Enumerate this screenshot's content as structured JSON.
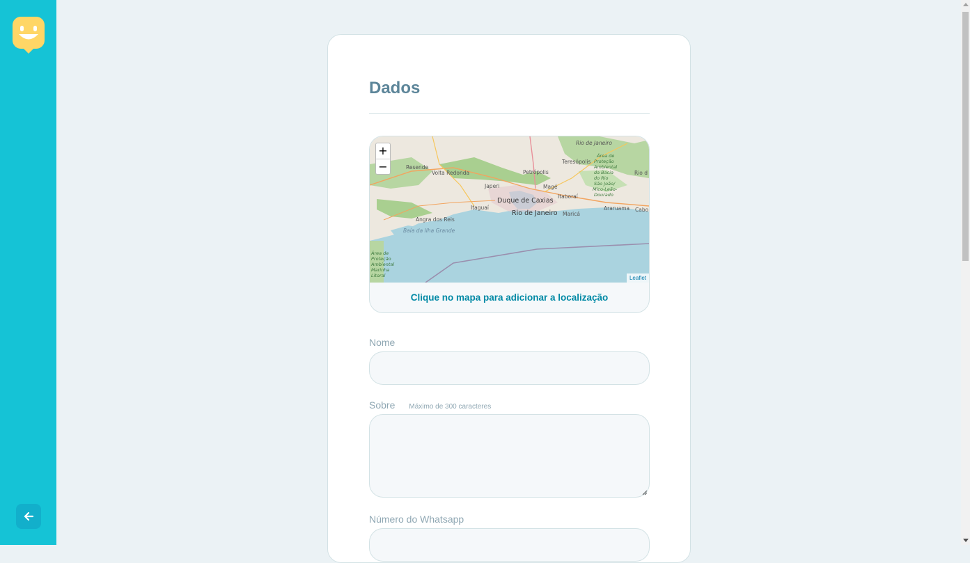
{
  "sidebar": {
    "logo_icon": "smiley-chat-icon",
    "back_icon": "arrow-left-icon"
  },
  "form": {
    "legend": "Dados",
    "map": {
      "zoom_in": "+",
      "zoom_out": "−",
      "attribution": "Leaflet",
      "cta": "Clique no mapa para adicionar a localização",
      "place_labels": [
        "Rio de Janeiro",
        "Teresópolis",
        "Resende",
        "Volta Redonda",
        "Petrópolis",
        "Área de Proteção Ambiental da Bacia do Rio São João/Mico-Leão-Dourado",
        "Rio d",
        "Japeri",
        "Magé",
        "Duque de Caxias",
        "Itaboraí",
        "Itaguaí",
        "Rio de Janeiro",
        "Maricá",
        "Araruama",
        "Cabo",
        "Angra dos Reis",
        "Baía da Ilha Grande",
        "Área de Proteção Ambiental Marinha Litoral"
      ]
    },
    "fields": {
      "name_label": "Nome",
      "name_value": "",
      "about_label": "Sobre",
      "about_hint": "Máximo de 300 caracteres",
      "about_value": "",
      "whatsapp_label": "Número do Whatsapp",
      "whatsapp_value": ""
    }
  },
  "colors": {
    "sidebar": "#15c3d6",
    "background": "#ebf2f5",
    "title": "#5c8599",
    "accent_link": "#0089a5",
    "logo": "#ffd666"
  }
}
